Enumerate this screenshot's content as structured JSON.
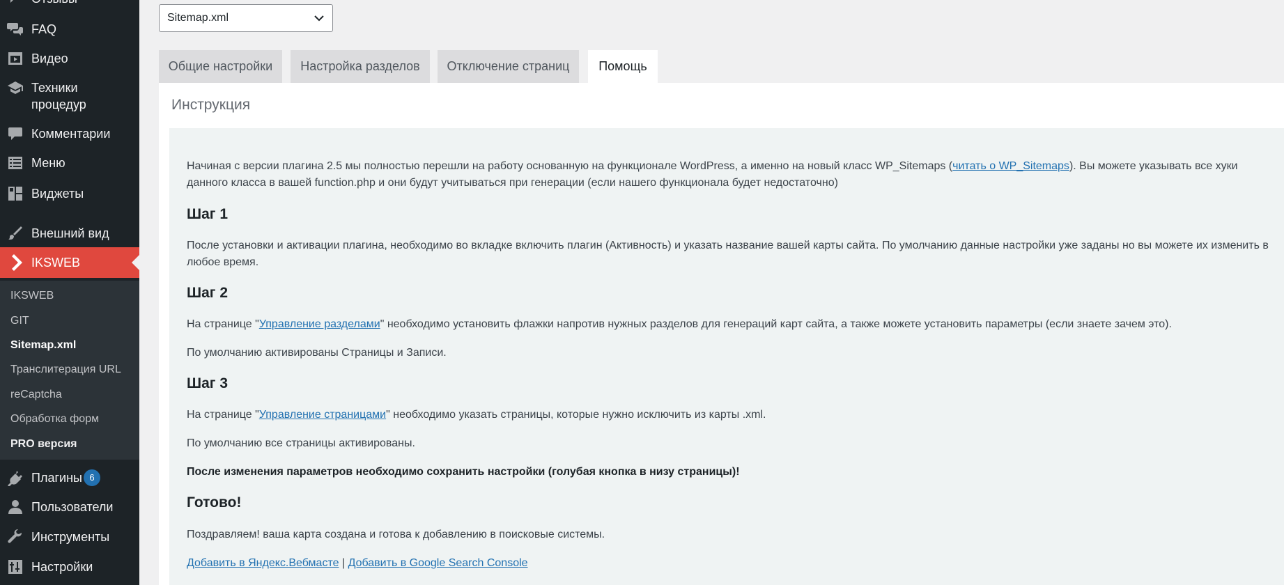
{
  "sidebar": {
    "items": [
      {
        "label": "Отзывы",
        "icon": "comments-icon"
      },
      {
        "label": "FAQ",
        "icon": "comments-icon"
      },
      {
        "label": "Видео",
        "icon": "video-icon"
      },
      {
        "label": "Техники процедур",
        "icon": "graduation-cap-icon"
      },
      {
        "label": "Комментарии",
        "icon": "comment-icon"
      },
      {
        "label": "Меню",
        "icon": "list-icon"
      },
      {
        "label": "Виджеты",
        "icon": "widgets-icon"
      },
      {
        "label": "Внешний вид",
        "icon": "paintbrush-icon"
      },
      {
        "label": "IKSWEB",
        "icon": "chevron-right-icon"
      },
      {
        "label": "Плагины",
        "icon": "plugin-icon",
        "badge": "6"
      },
      {
        "label": "Пользователи",
        "icon": "user-icon"
      },
      {
        "label": "Инструменты",
        "icon": "wrench-icon"
      },
      {
        "label": "Настройки",
        "icon": "settings-icon"
      }
    ],
    "techniques_line1": "Техники",
    "techniques_line2": "процедур",
    "submenu": [
      "IKSWEB",
      "GIT",
      "Sitemap.xml",
      "Транслитерация URL",
      "reCaptcha",
      "Обработка форм",
      "PRO версия"
    ]
  },
  "select": {
    "value": "Sitemap.xml"
  },
  "tabs": [
    "Общие настройки",
    "Настройка разделов",
    "Отключение страниц",
    "Помощь"
  ],
  "panel": {
    "title": "Инструкция",
    "intro_before": "Начиная с версии плагина 2.5 мы полностью перешли на работу основанную на функционале WordPress, а именно на новый класс WP_Sitemaps (",
    "intro_link": "читать о WP_Sitemaps",
    "intro_after": "). Вы можете указывать все хуки данного класса в вашей function.php и они будут учитываться при генерации (если нашего функционала будет недостаточно)",
    "step1_title": "Шаг 1",
    "step1_text": "После установки и активации плагина, необходимо во вкладке включить плагин (Активность) и указать название вашей карты сайта. По умолчанию данные настройки уже заданы но вы можете их изменить в любое время.",
    "step2_title": "Шаг 2",
    "step2_before": "На странице \"",
    "step2_link": "Управление разделами",
    "step2_after": "\" необходимо установить флажки напротив нужных разделов для генераций карт сайта, а также можете установить параметры (если знаете зачем это).",
    "step2_default": "По умолчанию активированы Страницы и Записи.",
    "step3_title": "Шаг 3",
    "step3_before": "На странице \"",
    "step3_link": "Управление страницами",
    "step3_after": "\" необходимо указать страницы, которые нужно исключить из карты .xml.",
    "step3_default": "По умолчанию все страницы активированы.",
    "save_note": "После изменения параметров необходимо сохранить настройки (голубая кнопка в низу страницы)!",
    "done_title": "Готово!",
    "done_text": "Поздравляем! ваша карта создана и готова к добавлению в поисковые системы.",
    "yandex_link": "Добавить в Яндекс.Вебмасте",
    "separator": "|",
    "google_link": "Добавить в Google Search Console"
  },
  "colors": {
    "accent": "#e0483e",
    "sidebar_bg": "#1d2327",
    "link": "#2271b1"
  }
}
